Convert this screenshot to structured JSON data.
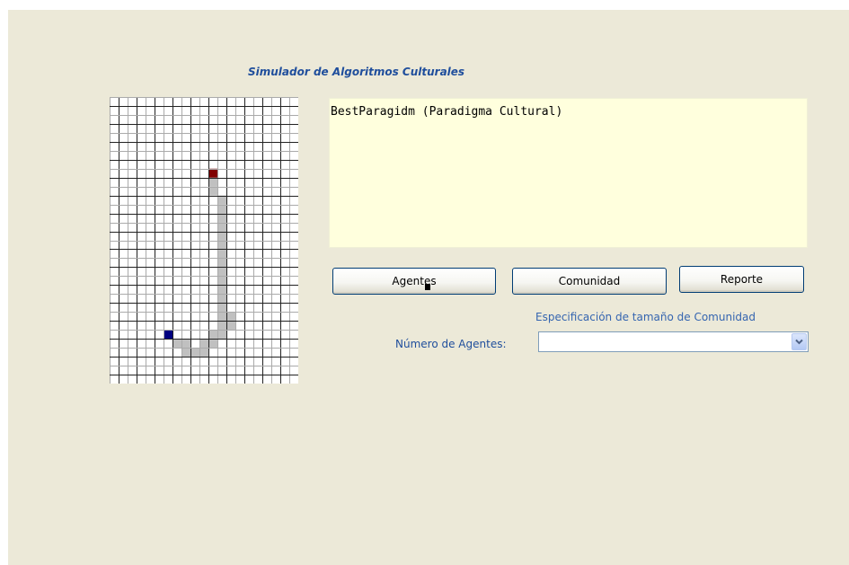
{
  "title": "Simulador de Algoritmos Culturales",
  "output_text": "BestParagidm (Paradigma Cultural)",
  "buttons": {
    "agentes": "Agentes",
    "comunidad": "Comunidad",
    "reporte": "Reporte"
  },
  "spec_label": "Especificación de tamaño de Comunidad",
  "agents_label": "Número de Agentes:",
  "agents_select": {
    "selected": ""
  },
  "grid": {
    "cols": 21,
    "rows": 32,
    "colors": {
      "background": "#ffffff",
      "line_light": "#aaaaaa",
      "line_dark": "#222222",
      "path": "#c0c0c0",
      "start": "#800000",
      "goal": "#000080"
    },
    "start_cell": [
      11,
      8
    ],
    "goal_cell": [
      6,
      26
    ],
    "path_cells": [
      [
        11,
        9
      ],
      [
        11,
        10
      ],
      [
        12,
        11
      ],
      [
        12,
        12
      ],
      [
        12,
        13
      ],
      [
        12,
        14
      ],
      [
        12,
        15
      ],
      [
        12,
        16
      ],
      [
        12,
        17
      ],
      [
        12,
        18
      ],
      [
        12,
        19
      ],
      [
        12,
        20
      ],
      [
        12,
        21
      ],
      [
        12,
        22
      ],
      [
        12,
        23
      ],
      [
        12,
        24
      ],
      [
        13,
        24
      ],
      [
        12,
        25
      ],
      [
        13,
        25
      ],
      [
        11,
        26
      ],
      [
        12,
        26
      ],
      [
        11,
        27
      ],
      [
        10,
        27
      ],
      [
        8,
        27
      ],
      [
        7,
        27
      ],
      [
        9,
        28
      ],
      [
        10,
        28
      ],
      [
        8,
        28
      ]
    ]
  },
  "icons": {
    "select_arrow": "chevron-down-icon"
  }
}
